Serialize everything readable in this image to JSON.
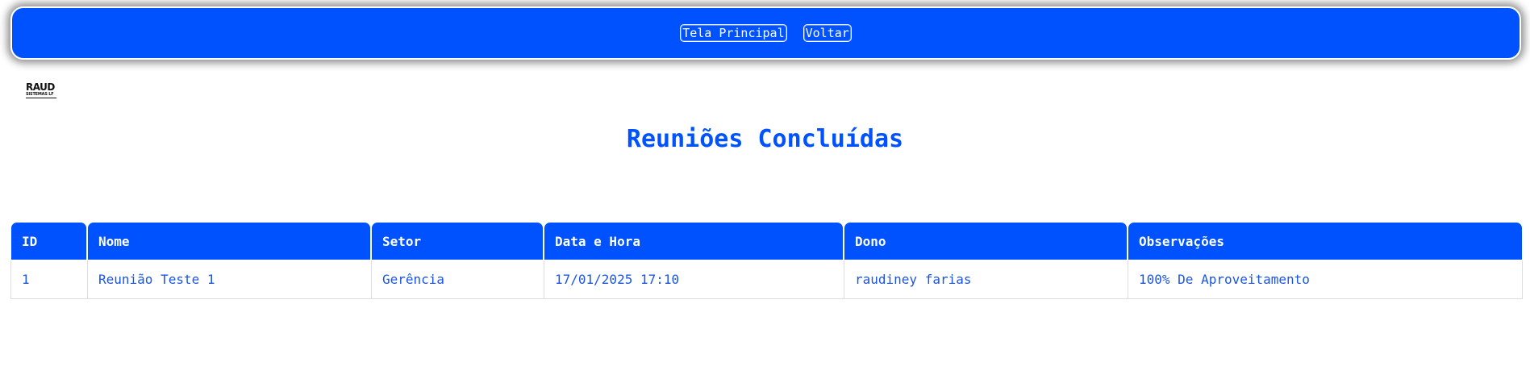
{
  "nav": {
    "home_label": "Tela Principal",
    "back_label": "Voltar"
  },
  "logo": {
    "text_main": "RAUD",
    "text_sub": "SISTEMAS LF"
  },
  "page": {
    "title": "Reuniões Concluídas"
  },
  "table": {
    "headers": [
      "ID",
      "Nome",
      "Setor",
      "Data e Hora",
      "Dono",
      "Observações"
    ],
    "rows": [
      [
        "1",
        "Reunião Teste 1",
        "Gerência",
        "17/01/2025 17:10",
        "raudiney farias",
        "100% De Aproveitamento"
      ]
    ]
  },
  "colors": {
    "primary": "#0052ff",
    "text_blue": "#1a55e6"
  }
}
